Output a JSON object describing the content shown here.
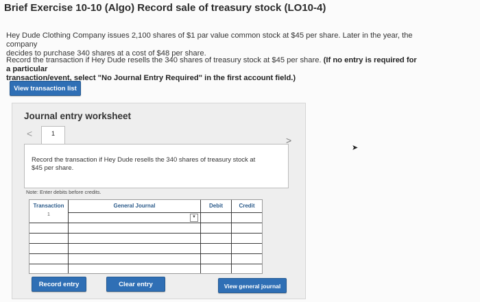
{
  "header": {
    "title": "Brief Exercise 10-10 (Algo) Record sale of treasury stock (LO10-4)"
  },
  "problem": {
    "intro_line1": "Hey Dude Clothing Company issues 2,100 shares of $1 par value common stock at $45 per share. Later in the year, the company",
    "intro_line2": "decides to purchase 340 shares at a cost of $48 per share.",
    "instruction_plain": "Record the transaction if Hey Dude resells the 340 shares of treasury stock at $45 per share.",
    "instruction_bold_1": "(If no entry is required for a particular",
    "instruction_bold_2": "transaction/event, select \"No Journal Entry Required\" in the first account field.)"
  },
  "buttons": {
    "view_transaction_list": "View transaction list",
    "record_entry": "Record entry",
    "clear_entry": "Clear entry",
    "view_general_journal": "View general journal"
  },
  "worksheet": {
    "title": "Journal entry worksheet",
    "tab_number": "1",
    "prev_glyph": "<",
    "next_glyph": ">",
    "description_line1": "Record the transaction if Hey Dude resells the 340 shares of treasury stock at",
    "description_line2": "$45 per share.",
    "note": "Note: Enter debits before credits.",
    "columns": {
      "transaction": "Transaction",
      "general_journal": "General Journal",
      "debit": "Debit",
      "credit": "Credit"
    },
    "rows": [
      {
        "transaction": "1",
        "account": "",
        "debit": "",
        "credit": ""
      },
      {
        "transaction": "",
        "account": "",
        "debit": "",
        "credit": ""
      },
      {
        "transaction": "",
        "account": "",
        "debit": "",
        "credit": ""
      },
      {
        "transaction": "",
        "account": "",
        "debit": "",
        "credit": ""
      },
      {
        "transaction": "",
        "account": "",
        "debit": "",
        "credit": ""
      },
      {
        "transaction": "",
        "account": "",
        "debit": "",
        "credit": ""
      }
    ]
  },
  "colors": {
    "button_blue": "#2f6fb5",
    "header_text_blue": "#2a5a8a"
  }
}
